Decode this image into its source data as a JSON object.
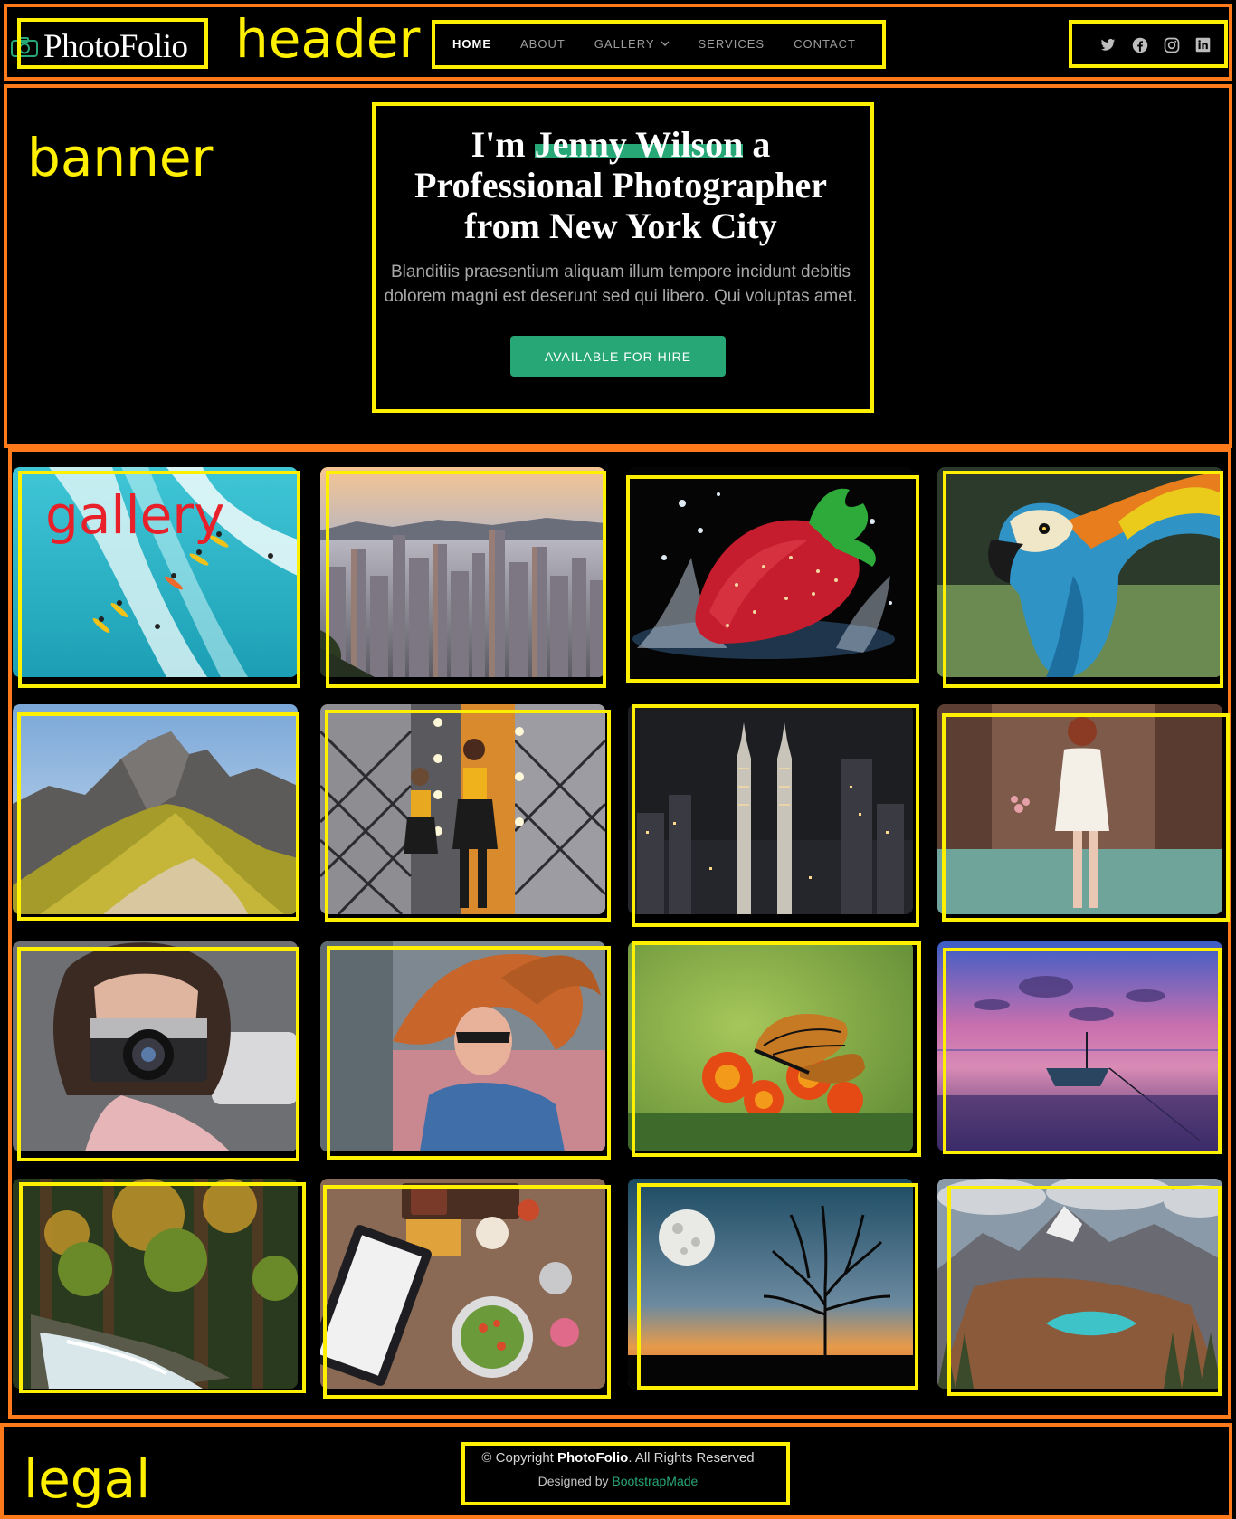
{
  "header": {
    "logo_text": "PhotoFolio",
    "nav": [
      {
        "label": "HOME",
        "active": true
      },
      {
        "label": "ABOUT"
      },
      {
        "label": "GALLERY",
        "dropdown": true
      },
      {
        "label": "SERVICES"
      },
      {
        "label": "CONTACT"
      }
    ],
    "social_icons": [
      "twitter-icon",
      "facebook-icon",
      "instagram-icon",
      "linkedin-icon"
    ]
  },
  "hero": {
    "title_prefix": "I'm",
    "title_name": "Jenny Wilson",
    "title_suffix": "a Professional Photographer from New York City",
    "subtitle": "Blanditiis praesentium aliquam illum tempore incidunt debitis dolorem magni est deserunt sed qui libero. Qui voluptas amet.",
    "cta_label": "AVAILABLE FOR HIRE"
  },
  "gallery": {
    "images": [
      "surfers-on-wave",
      "city-skyline-sunset",
      "strawberry-splash",
      "macaw-parrot",
      "mountain-ridge",
      "women-mirror-room",
      "twin-towers-night",
      "woman-in-forest",
      "woman-with-camera",
      "woman-hair-flying",
      "butterfly-on-marigold",
      "boat-on-lake-sunset",
      "forest-waterfall",
      "food-table-top",
      "moon-and-tree-silhouette",
      "mountain-lake-valley"
    ]
  },
  "footer": {
    "copyright_prefix": "© Copyright",
    "copyright_brand": "PhotoFolio",
    "copyright_suffix": ". All Rights Reserved",
    "designed_prefix": "Designed by",
    "designed_link": "BootstrapMade"
  },
  "annotations": {
    "header": "header",
    "banner": "banner",
    "gallery": "gallery",
    "legal": "legal"
  },
  "colors": {
    "accent": "#27a776",
    "annotation_box": "#ffef00",
    "section_box": "#ff7a1a",
    "gallery_label": "#e8202a"
  }
}
